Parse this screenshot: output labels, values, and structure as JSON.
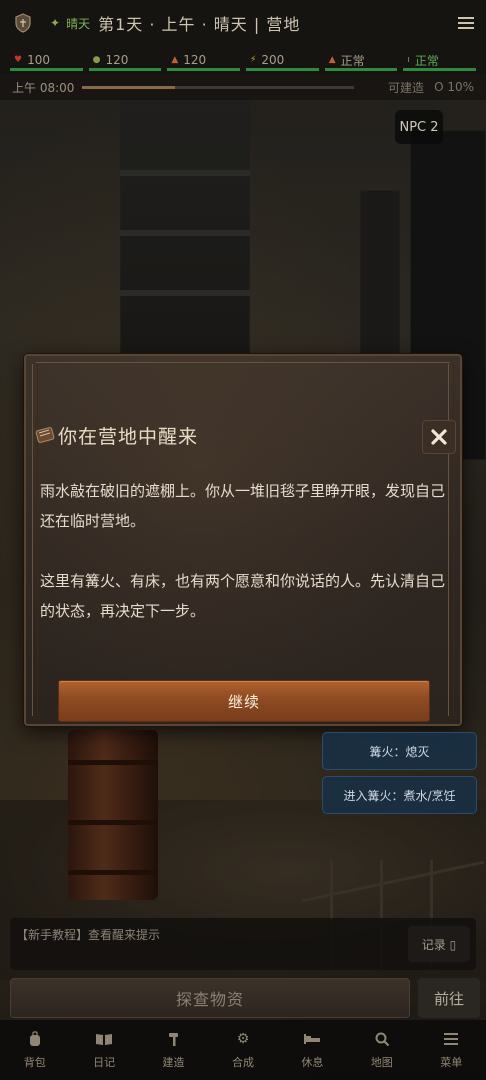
{
  "topbar": {
    "weather": "晴天",
    "title": "第1天 · 上午 · 晴天 | 营地"
  },
  "stats": [
    {
      "icon": "health-icon",
      "value": "100",
      "color": "#c0392b"
    },
    {
      "icon": "food-icon",
      "value": "120",
      "color": "#8a9a4a"
    },
    {
      "icon": "water-icon",
      "value": "120",
      "color": "#c0603a"
    },
    {
      "icon": "energy-icon",
      "value": "200",
      "color": "#d4b23a"
    },
    {
      "icon": "status-icon",
      "value": "正常",
      "color": "#c0603a"
    },
    {
      "icon": "mood-icon",
      "value": "正常",
      "color": "#5fa85a"
    }
  ],
  "timeline": {
    "time": "上午 08:00",
    "progress": 0.34,
    "buildable_label": "可建造",
    "buildable_value": "O 10%"
  },
  "npc_button": "NPC 2",
  "dialog": {
    "title": "你在营地中醒来",
    "paragraphs": [
      "雨水敲在破旧的遮棚上。你从一堆旧毯子里睁开眼，发现自己还在临时营地。",
      "这里有篝火、有床，也有两个愿意和你说话的人。先认清自己的状态，再决定下一步。"
    ],
    "continue_label": "继续"
  },
  "actions": [
    {
      "label": "篝火：熄灭"
    },
    {
      "label": "进入篝火：煮水/烹饪"
    }
  ],
  "log": {
    "text": "【新手教程】查看醒来提示",
    "button": "记录 ▯"
  },
  "explore_label": "探查物资",
  "goto_label": "前往",
  "nav": [
    {
      "label": "背包",
      "icon": "backpack-icon"
    },
    {
      "label": "日记",
      "icon": "journal-icon"
    },
    {
      "label": "建造",
      "icon": "hammer-icon"
    },
    {
      "label": "合成",
      "icon": "gear-icon"
    },
    {
      "label": "休息",
      "icon": "bed-icon"
    },
    {
      "label": "地图",
      "icon": "search-map-icon"
    },
    {
      "label": "菜单",
      "icon": "menu-icon"
    }
  ]
}
